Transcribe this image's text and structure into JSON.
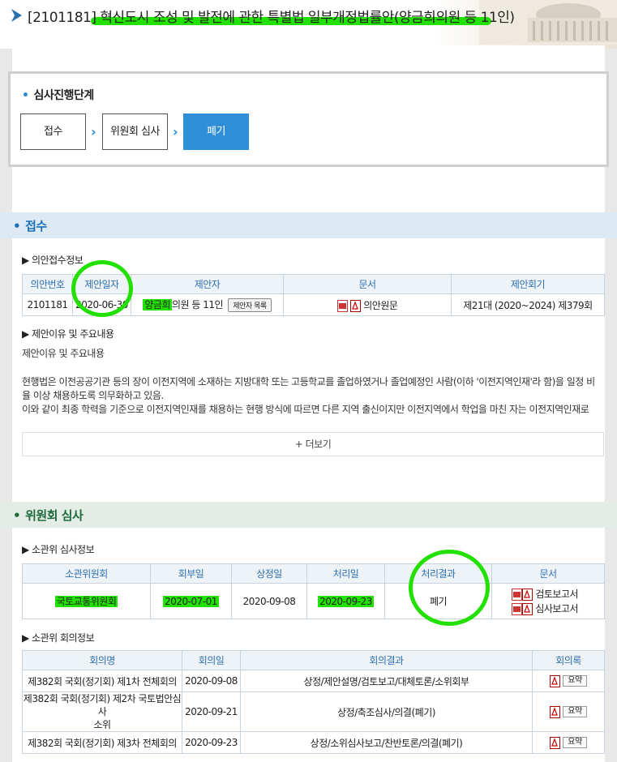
{
  "header": {
    "title": "[2101181] 혁신도시 조성 및 발전에 관한 특별법 일부개정법률안(양금희의원 등 11인)"
  },
  "stage": {
    "title": "심사진행단계",
    "steps": [
      "접수",
      "위원회 심사",
      "폐기"
    ]
  },
  "receipt": {
    "section_title": "접수",
    "info_title": "▶ 의안접수정보",
    "columns": [
      "의안번호",
      "제안일자",
      "제안자",
      "문서",
      "제안회기"
    ],
    "row": {
      "bill_no": "2101181",
      "date": "2020-06-30",
      "proposer_name": "양금희",
      "proposer_rest": "의원 등 11인",
      "proposer_button": "제안자 목록",
      "document": "의안원문",
      "session": "제21대 (2020~2024) 제379회"
    },
    "reason_title": "▶ 제안이유 및 주요내용",
    "reason_label": "제안이유 및 주요내용",
    "reason_text_1": "현행법은 이전공공기관 등의 장이 이전지역에 소재하는 지방대학 또는 고등학교를 졸업하였거나 졸업예정인 사람(이하 '이전지역인재'라 함)을 일정 비율 이상 채용하도록 의무화하고 있음.",
    "reason_text_2": "이와 같이 최종 학력을 기준으로 이전지역인재를 채용하는 현행 방식에 따르면 다른 지역 출신이지만 이전지역에서 학업을 마친 자는 이전지역인재로",
    "more_label": "+ 더보기"
  },
  "committee": {
    "section_title": "위원회 심사",
    "info_title": "▶ 소관위 심사정보",
    "columns": [
      "소관위원회",
      "회부일",
      "상정일",
      "처리일",
      "처리결과",
      "문서"
    ],
    "row": {
      "committee": "국토교통위원회",
      "referral_date": "2020-07-01",
      "present_date": "2020-09-08",
      "process_date": "2020-09-23",
      "result": "폐기",
      "doc1": "검토보고서",
      "doc2": "심사보고서"
    },
    "meeting_title": "▶ 소관위 회의정보",
    "meeting_columns": [
      "회의명",
      "회의일",
      "회의결과",
      "회의록"
    ],
    "meetings": [
      {
        "name": "제382회 국회(정기회) 제1차 전체회의",
        "date": "2020-09-08",
        "result": "상정/제안설명/검토보고/대체토론/소위회부",
        "summary": "요약"
      },
      {
        "name_1": "제382회 국회(정기회) 제2차 국토법안심사",
        "name_2": "소위",
        "date": "2020-09-21",
        "result": "상정/축조심사/의결(폐기)",
        "summary": "요약"
      },
      {
        "name": "제382회 국회(정기회) 제3차 전체회의",
        "date": "2020-09-23",
        "result": "상정/소위심사보고/찬반토론/의결(폐기)",
        "summary": "요약"
      }
    ]
  },
  "colors": {
    "accent_blue": "#2f8ed8",
    "highlight_green": "#22e000",
    "header_bg": "#dde9f3"
  }
}
